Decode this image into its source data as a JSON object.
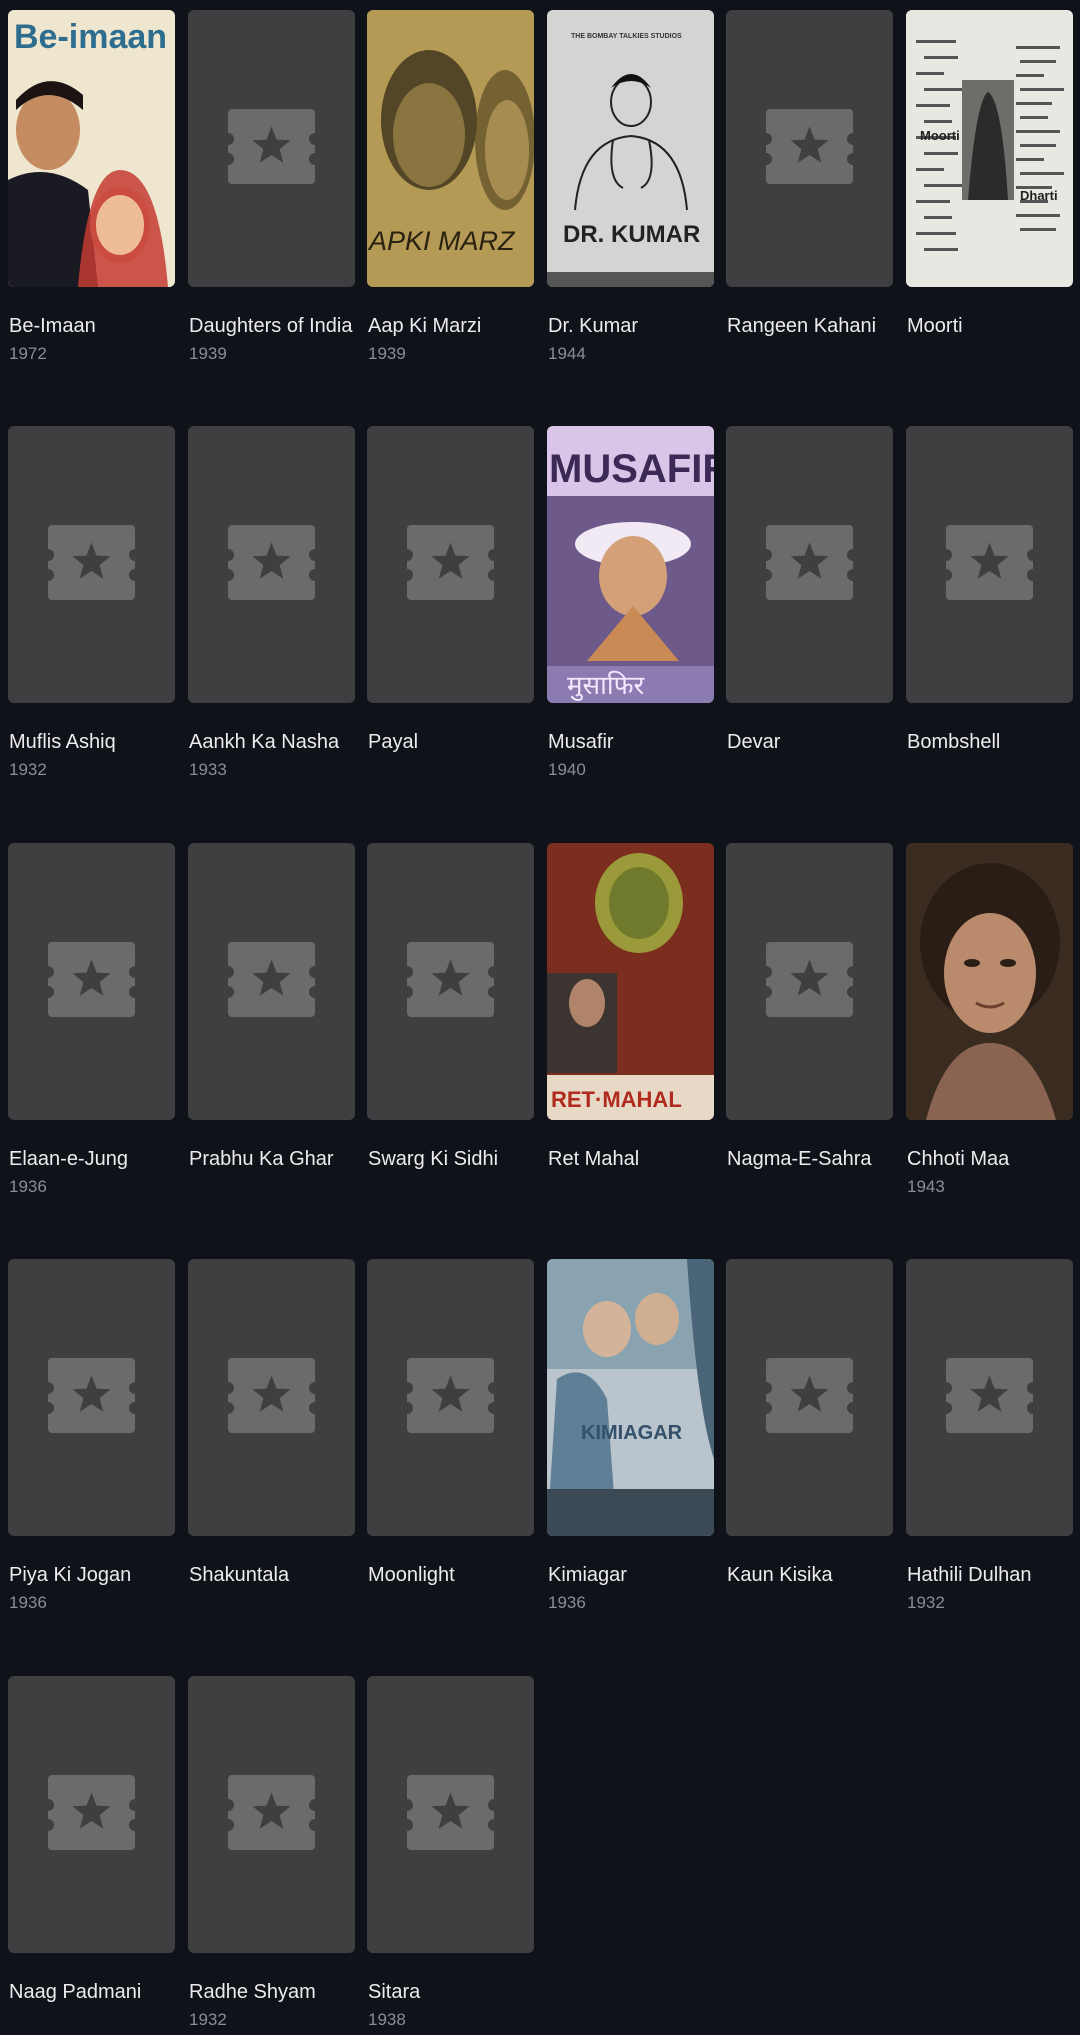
{
  "colors": {
    "background": "#10121a",
    "placeholder": "#3f3f41",
    "placeholder_icon": "#6b6b6b",
    "title": "#ececec",
    "year": "#8b8d93"
  },
  "placeholder_icon": "ticket-star-icon",
  "movies": [
    {
      "title": "Be-Imaan",
      "year": "1972",
      "poster": "be-imaan"
    },
    {
      "title": "Daughters of India",
      "year": "1939",
      "poster": null
    },
    {
      "title": "Aap Ki Marzi",
      "year": "1939",
      "poster": "aap-ki-marzi"
    },
    {
      "title": "Dr. Kumar",
      "year": "1944",
      "poster": "dr-kumar"
    },
    {
      "title": "Rangeen Kahani",
      "year": "",
      "poster": null
    },
    {
      "title": "Moorti",
      "year": "",
      "poster": "moorti"
    },
    {
      "title": "Muflis Ashiq",
      "year": "1932",
      "poster": null
    },
    {
      "title": "Aankh Ka Nasha",
      "year": "1933",
      "poster": null
    },
    {
      "title": "Payal",
      "year": "",
      "poster": null
    },
    {
      "title": "Musafir",
      "year": "1940",
      "poster": "musafir"
    },
    {
      "title": "Devar",
      "year": "",
      "poster": null
    },
    {
      "title": "Bombshell",
      "year": "",
      "poster": null
    },
    {
      "title": "Elaan-e-Jung",
      "year": "1936",
      "poster": null
    },
    {
      "title": "Prabhu Ka Ghar",
      "year": "",
      "poster": null
    },
    {
      "title": "Swarg Ki Sidhi",
      "year": "",
      "poster": null
    },
    {
      "title": "Ret Mahal",
      "year": "",
      "poster": "ret-mahal"
    },
    {
      "title": "Nagma-E-Sahra",
      "year": "",
      "poster": null
    },
    {
      "title": "Chhoti Maa",
      "year": "1943",
      "poster": "chhoti-maa"
    },
    {
      "title": "Piya Ki Jogan",
      "year": "1936",
      "poster": null
    },
    {
      "title": "Shakuntala",
      "year": "",
      "poster": null
    },
    {
      "title": "Moonlight",
      "year": "",
      "poster": null
    },
    {
      "title": "Kimiagar",
      "year": "1936",
      "poster": "kimiagar"
    },
    {
      "title": "Kaun Kisika",
      "year": "",
      "poster": null
    },
    {
      "title": "Hathili Dulhan",
      "year": "1932",
      "poster": null
    },
    {
      "title": "Naag Padmani",
      "year": "",
      "poster": null
    },
    {
      "title": "Radhe Shyam",
      "year": "1932",
      "poster": null
    },
    {
      "title": "Sitara",
      "year": "1938",
      "poster": null
    }
  ],
  "poster_text": {
    "be-imaan": "Be-imaan",
    "aap-ki-marzi": "APKI MARZ",
    "dr-kumar": "DR. KUMAR",
    "dr-kumar-top": "THE BOMBAY TALKIES STUDIOS",
    "musafir": "MUSAFIR",
    "musafir-hindi": "मुसाफिर",
    "ret-mahal": "RET·MAHAL",
    "kimiagar": "KIMIAGAR",
    "moorti": "Moorti",
    "moorti-sub": "Dharti"
  }
}
